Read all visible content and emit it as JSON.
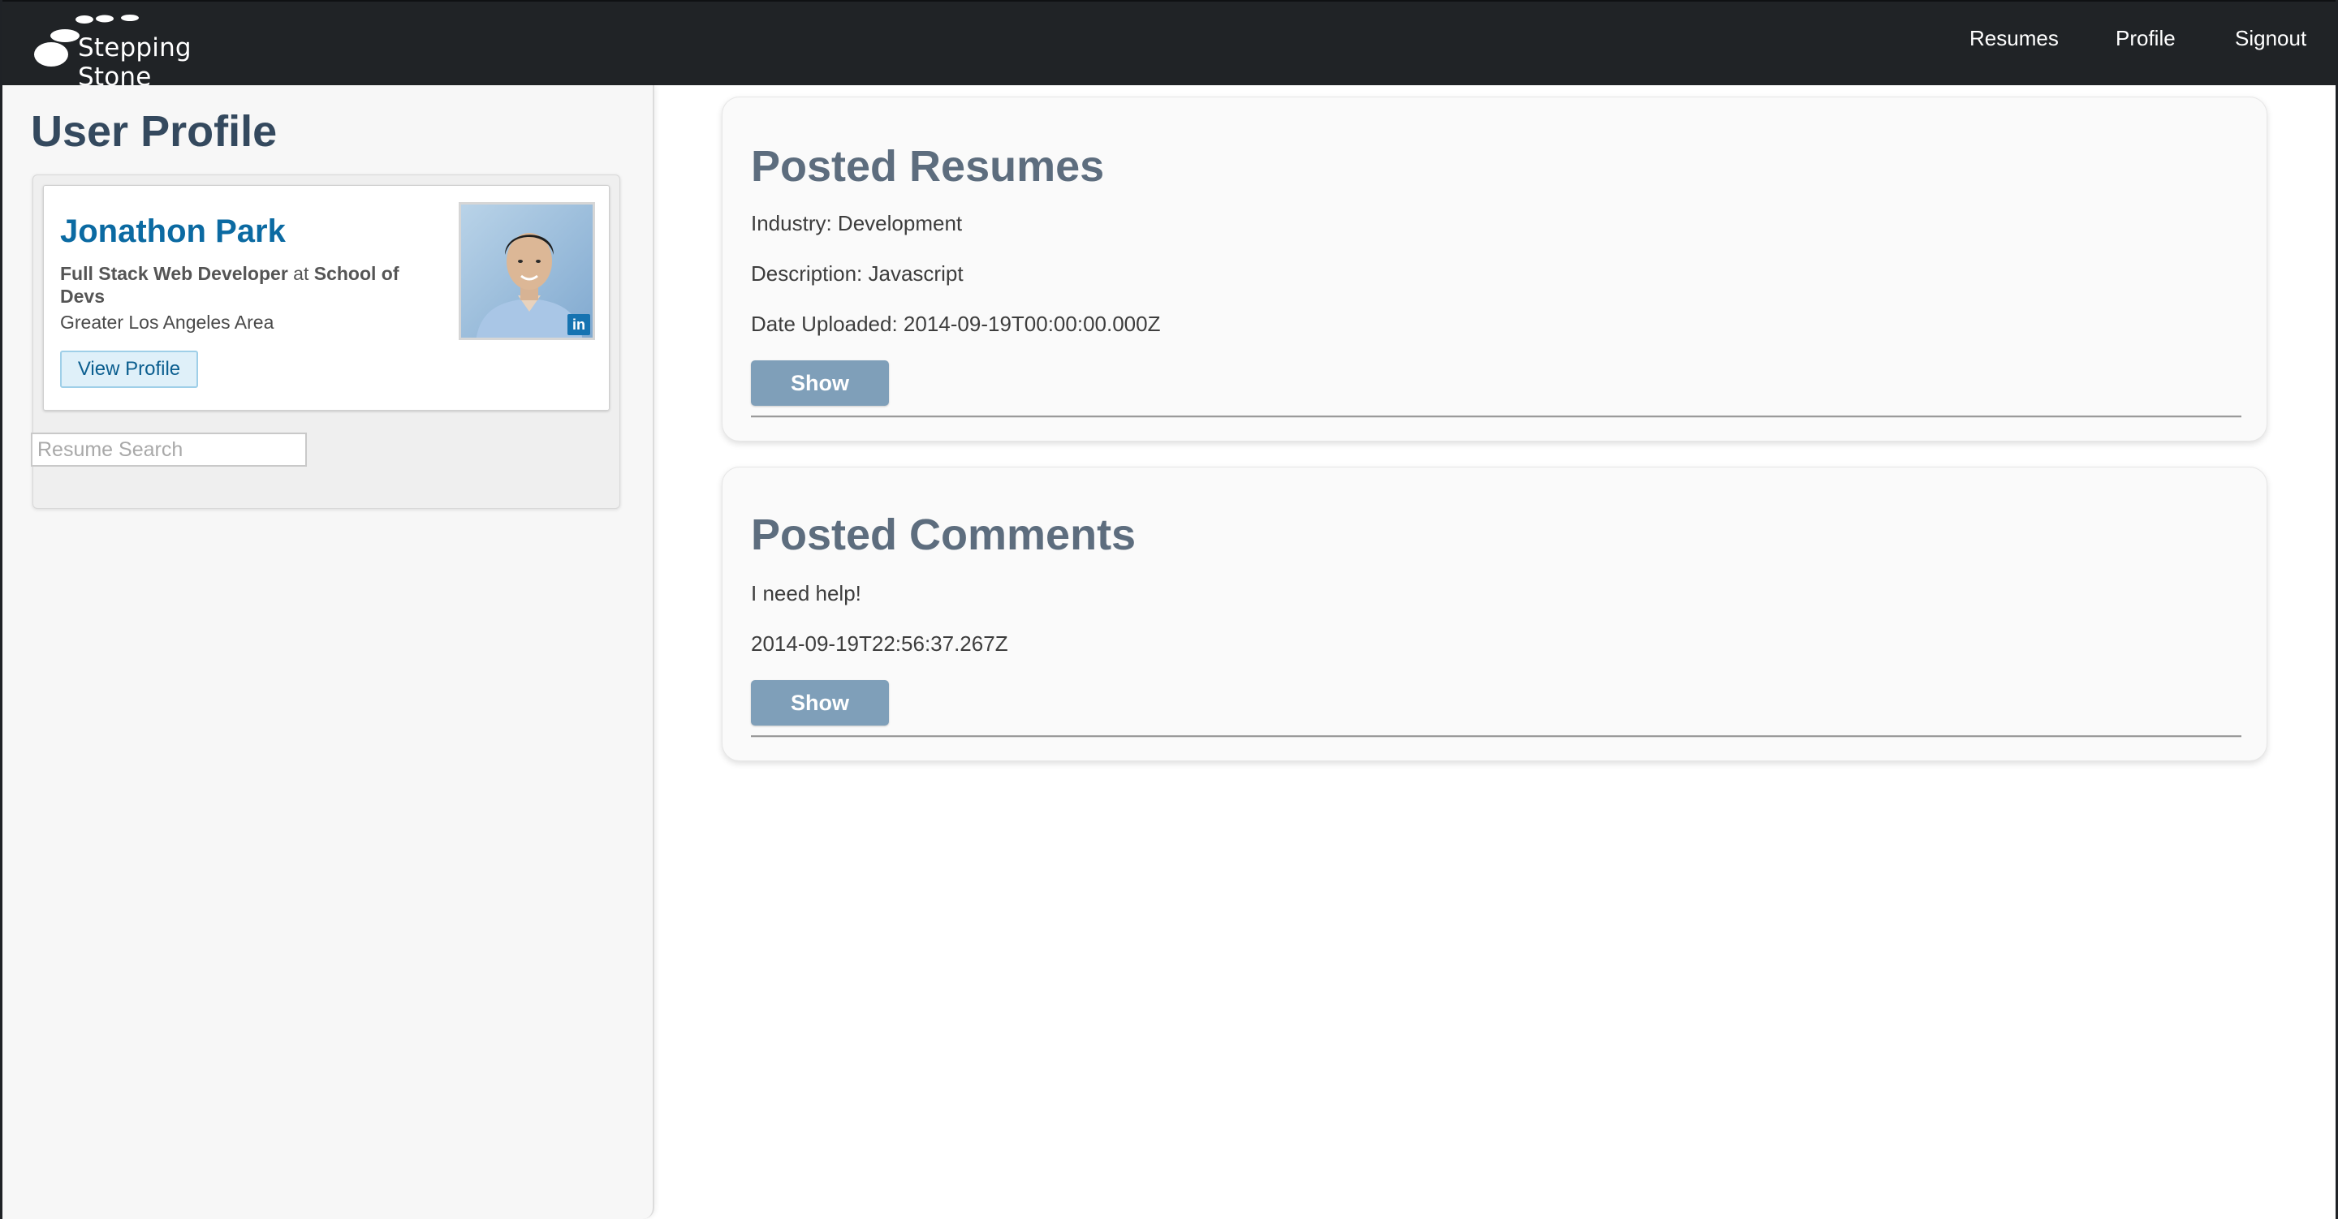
{
  "nav": {
    "brand": "Stepping Stone",
    "links": [
      "Resumes",
      "Profile",
      "Signout"
    ]
  },
  "sidebar": {
    "title": "User Profile",
    "profile_card": {
      "name": "Jonathon Park",
      "role": "Full Stack Web Developer",
      "connector": "at",
      "company": "School of Devs",
      "location": "Greater Los Angeles Area",
      "button_label": "View Profile",
      "badge_text": "in"
    },
    "search": {
      "placeholder": "Resume Search",
      "value": ""
    }
  },
  "posted_resumes": {
    "title": "Posted Resumes",
    "industry": "Industry: Development",
    "description": "Description: Javascript",
    "date_uploaded": "Date Uploaded: 2014-09-19T00:00:00.000Z",
    "button_label": "Show"
  },
  "posted_comments": {
    "title": "Posted Comments",
    "comment": "I need help!",
    "timestamp": "2014-09-19T22:56:37.267Z",
    "button_label": "Show"
  },
  "colors": {
    "navbar": "#202326",
    "heading": "#34495e",
    "panel_heading": "#5d6d7e",
    "show_button": "#7f9fb9",
    "linkedin_blue": "#0b6aa2"
  }
}
